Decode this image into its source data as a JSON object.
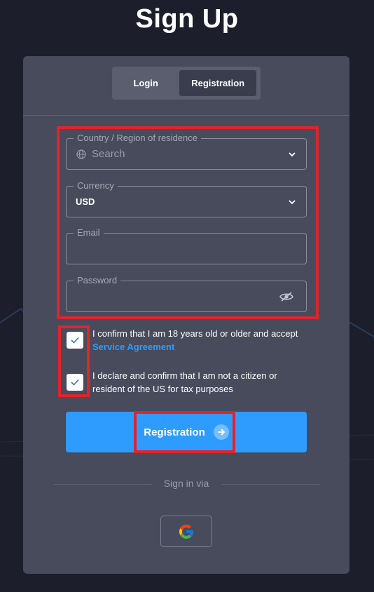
{
  "page": {
    "title": "Sign Up"
  },
  "tabs": [
    {
      "label": "Login",
      "active": false
    },
    {
      "label": "Registration",
      "active": true
    }
  ],
  "form": {
    "country": {
      "legend": "Country / Region of residence",
      "placeholder": "Search",
      "icon": "globe-icon"
    },
    "currency": {
      "legend": "Currency",
      "value": "USD"
    },
    "email": {
      "legend": "Email",
      "value": ""
    },
    "password": {
      "legend": "Password",
      "value": "",
      "icon": "eye-off-icon"
    }
  },
  "checks": [
    {
      "text": "I confirm that I am 18 years old or older and accept",
      "link": "Service Agreement",
      "checked": true
    },
    {
      "text": "I declare and confirm that I am not a citizen or resident of the US for tax purposes",
      "checked": true
    }
  ],
  "submit": {
    "label": "Registration",
    "icon": "arrow-right-icon"
  },
  "social": {
    "divider_label": "Sign in via",
    "google_icon": "google-icon"
  },
  "colors": {
    "accent": "#2e9cff",
    "card": "#474b5b",
    "background": "#1c1f2b",
    "highlight": "#e0242b"
  }
}
